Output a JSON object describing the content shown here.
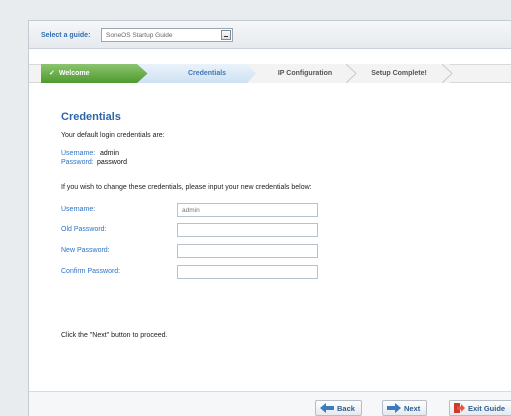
{
  "guide": {
    "label": "Select a guide:",
    "selected": "SoneOS Startup Guide"
  },
  "steps": [
    {
      "label": "Welcome",
      "state": "done"
    },
    {
      "label": "Credentials",
      "state": "current"
    },
    {
      "label": "IP Configuration",
      "state": "pending"
    },
    {
      "label": "Setup Complete!",
      "state": "pending"
    }
  ],
  "content": {
    "title": "Credentials",
    "intro": "Your default login credentials are:",
    "default_username_label": "Username:",
    "default_username_value": "admin",
    "default_password_label": "Password:",
    "default_password_value": "password",
    "change_hint": "If you wish to change these credentials, please input your new credentials below:",
    "form": {
      "username_label": "Username:",
      "username_placeholder": "admin",
      "old_password_label": "Old Password:",
      "new_password_label": "New Password:",
      "confirm_password_label": "Confirm Password:"
    },
    "proceed_hint": "Click the \"Next\" button to proceed."
  },
  "footer": {
    "back_label": "Back",
    "next_label": "Next",
    "exit_label": "Exit Guide"
  },
  "colors": {
    "accent_blue": "#2f73c4",
    "done_green": "#4e9a2e",
    "exit_red": "#d03a2a"
  }
}
